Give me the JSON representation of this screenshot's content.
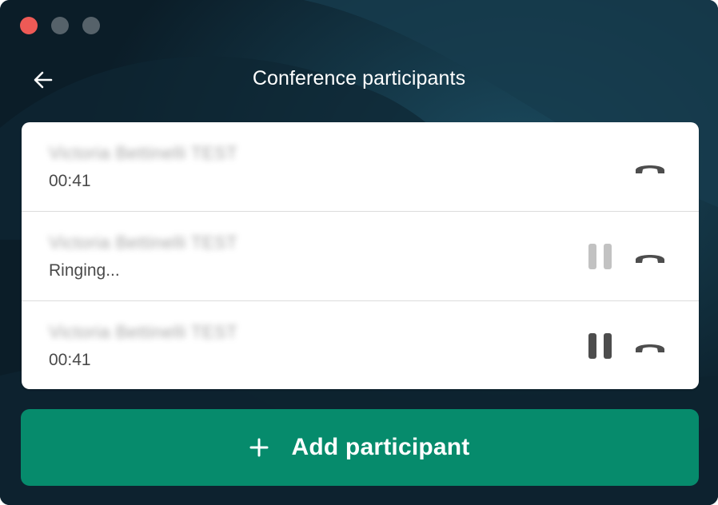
{
  "window": {
    "controls": [
      "close",
      "minimize",
      "maximize"
    ],
    "colors": {
      "close": "#ee5a56",
      "inactive": "#56626a"
    }
  },
  "header": {
    "back_icon": "arrow-left-icon",
    "title": "Conference participants"
  },
  "participants": [
    {
      "name": "Victoria Bettinelli TEST",
      "status": "00:41",
      "hold_button": "none",
      "hangup_icon": "phone-hangup-icon"
    },
    {
      "name": "Victoria Bettinelli TEST",
      "status": "Ringing...",
      "hold_button": "disabled",
      "hangup_icon": "phone-hangup-icon"
    },
    {
      "name": "Victoria Bettinelli TEST",
      "status": "00:41",
      "hold_button": "enabled",
      "hangup_icon": "phone-hangup-icon"
    }
  ],
  "add_button": {
    "icon": "plus-icon",
    "label": "Add participant"
  },
  "colors": {
    "accent": "#068b6c",
    "background": "#0b1d28"
  }
}
